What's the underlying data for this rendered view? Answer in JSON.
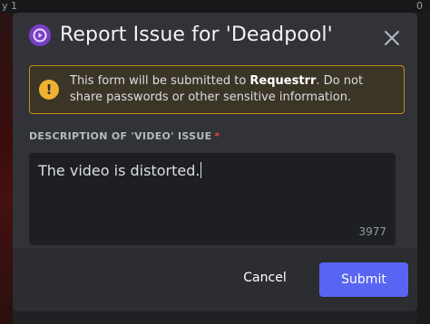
{
  "background": {
    "crumb_left": "y 1",
    "crumb_right": "0"
  },
  "modal": {
    "title": "Report Issue for 'Deadpool'",
    "warning": {
      "text_before": "This form will be submitted to ",
      "text_bold": "Requestrr",
      "text_after": ". Do not share passwords or other sensitive information."
    },
    "field": {
      "label": "DESCRIPTION OF 'VIDEO' ISSUE",
      "required_mark": "*",
      "value": "The video is distorted.",
      "char_count": "3977"
    },
    "buttons": {
      "cancel_label": "Cancel",
      "submit_label": "Submit"
    }
  },
  "icons": {
    "app": "requestrr-app-icon",
    "close": "close-icon",
    "warning": "warning-icon"
  },
  "colors": {
    "accent": "#5865f2",
    "warning_border": "#c48b15",
    "warning_icon": "#f0b232",
    "required": "#f23f42",
    "app_icon": "#7a3fc4"
  }
}
